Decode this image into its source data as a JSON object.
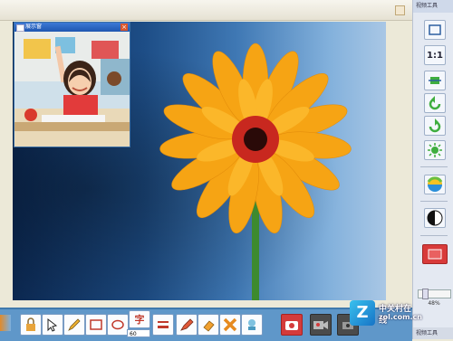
{
  "right_panel": {
    "title": "视频工具",
    "ratio_label": "1:1",
    "zoom_value": "48%",
    "footer_label": "视频工具"
  },
  "pip_window": {
    "title": "展示窗"
  },
  "toolbar": {
    "text_tool_glyph": "字",
    "size_select": "60"
  },
  "watermark": {
    "name": "中关村在线",
    "url": "zol.com.cn",
    "logo_letter": "Z"
  },
  "colors": {
    "toolbar_bg": "#5f97c9",
    "panel_bg": "#e4e9f2",
    "flower_petal": "#f6a414",
    "flower_center": "#c8281f",
    "camera_button": "#d43b3b"
  }
}
